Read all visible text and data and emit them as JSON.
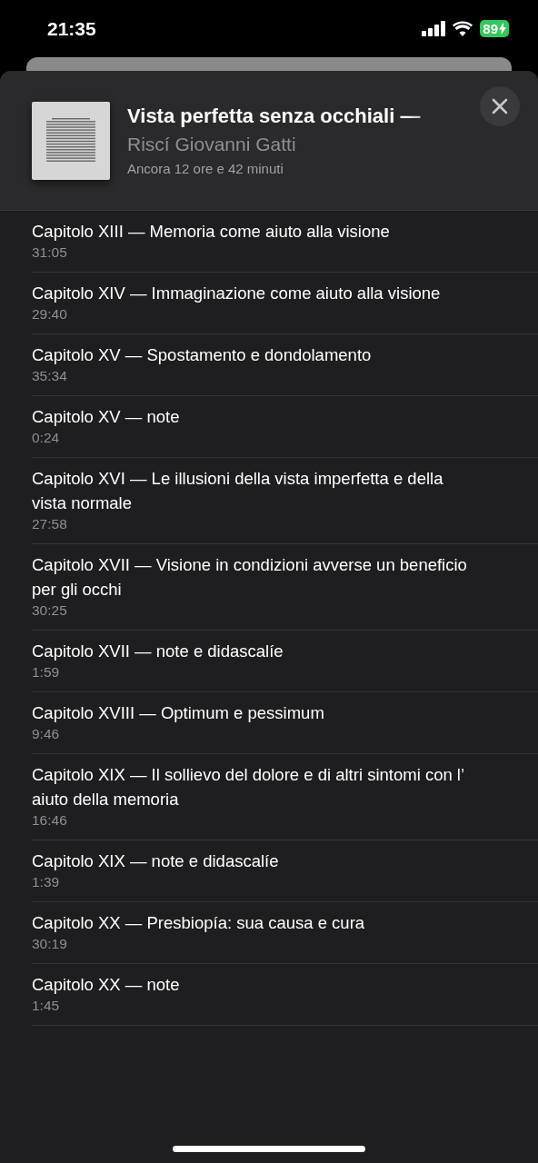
{
  "status_bar": {
    "time": "21:35",
    "battery": "89"
  },
  "book": {
    "title": "Vista perfetta senza occhiali —",
    "narrator": "Riscí Giovanni Gatti",
    "remaining": "Ancora 12 ore e 42 minuti"
  },
  "chapters": [
    {
      "title": "Capitolo XIII — Memoria come aiuto alla visione",
      "duration": "31:05"
    },
    {
      "title": "Capitolo XIV — Immaginazione come aiuto alla visione",
      "duration": "29:40"
    },
    {
      "title": "Capitolo XV — Spostamento e dondolamento",
      "duration": "35:34"
    },
    {
      "title": "Capitolo XV — note",
      "duration": "0:24"
    },
    {
      "title": "Capitolo XVI — Le illusioni della vista imperfetta e della vista normale",
      "duration": "27:58"
    },
    {
      "title": "Capitolo XVII — Visione in condizioni avverse un beneficio per gli occhi",
      "duration": "30:25"
    },
    {
      "title": "Capitolo XVII — note e didascalíe",
      "duration": "1:59"
    },
    {
      "title": "Capitolo XVIII — Optimum e pessimum",
      "duration": "9:46"
    },
    {
      "title": "Capitolo XIX — Il sollievo del dolore e di altri sintomi con l’ aiuto della memoria",
      "duration": "16:46"
    },
    {
      "title": "Capitolo XIX — note e didascalíe",
      "duration": "1:39"
    },
    {
      "title": "Capitolo XX — Presbiopía: sua causa e cura",
      "duration": "30:19"
    },
    {
      "title": "Capitolo XX — note",
      "duration": "1:45"
    }
  ]
}
